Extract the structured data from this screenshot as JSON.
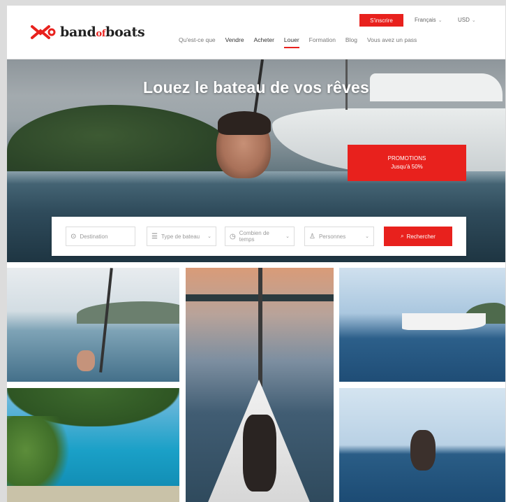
{
  "header": {
    "logo_text_pre": "band",
    "logo_text_of": "of",
    "logo_text_post": "boats",
    "cta_label": "S'inscrire",
    "language": "Français",
    "currency": "USD",
    "nav": [
      "Qu'est-ce que",
      "Vendre",
      "Acheter",
      "Louer",
      "Formation",
      "Blog",
      "Vous avez un pass"
    ]
  },
  "hero": {
    "title": "Louez le bateau de vos rêves",
    "promo_line1": "PROMOTIONS",
    "promo_line2": "Jusqu'à 50%"
  },
  "search": {
    "destination_placeholder": "Destination",
    "boat_type": "Type de bateau",
    "duration": "Combien de temps",
    "persons": "Personnes",
    "button_label": "Rechercher"
  },
  "colors": {
    "accent": "#e8211d"
  }
}
